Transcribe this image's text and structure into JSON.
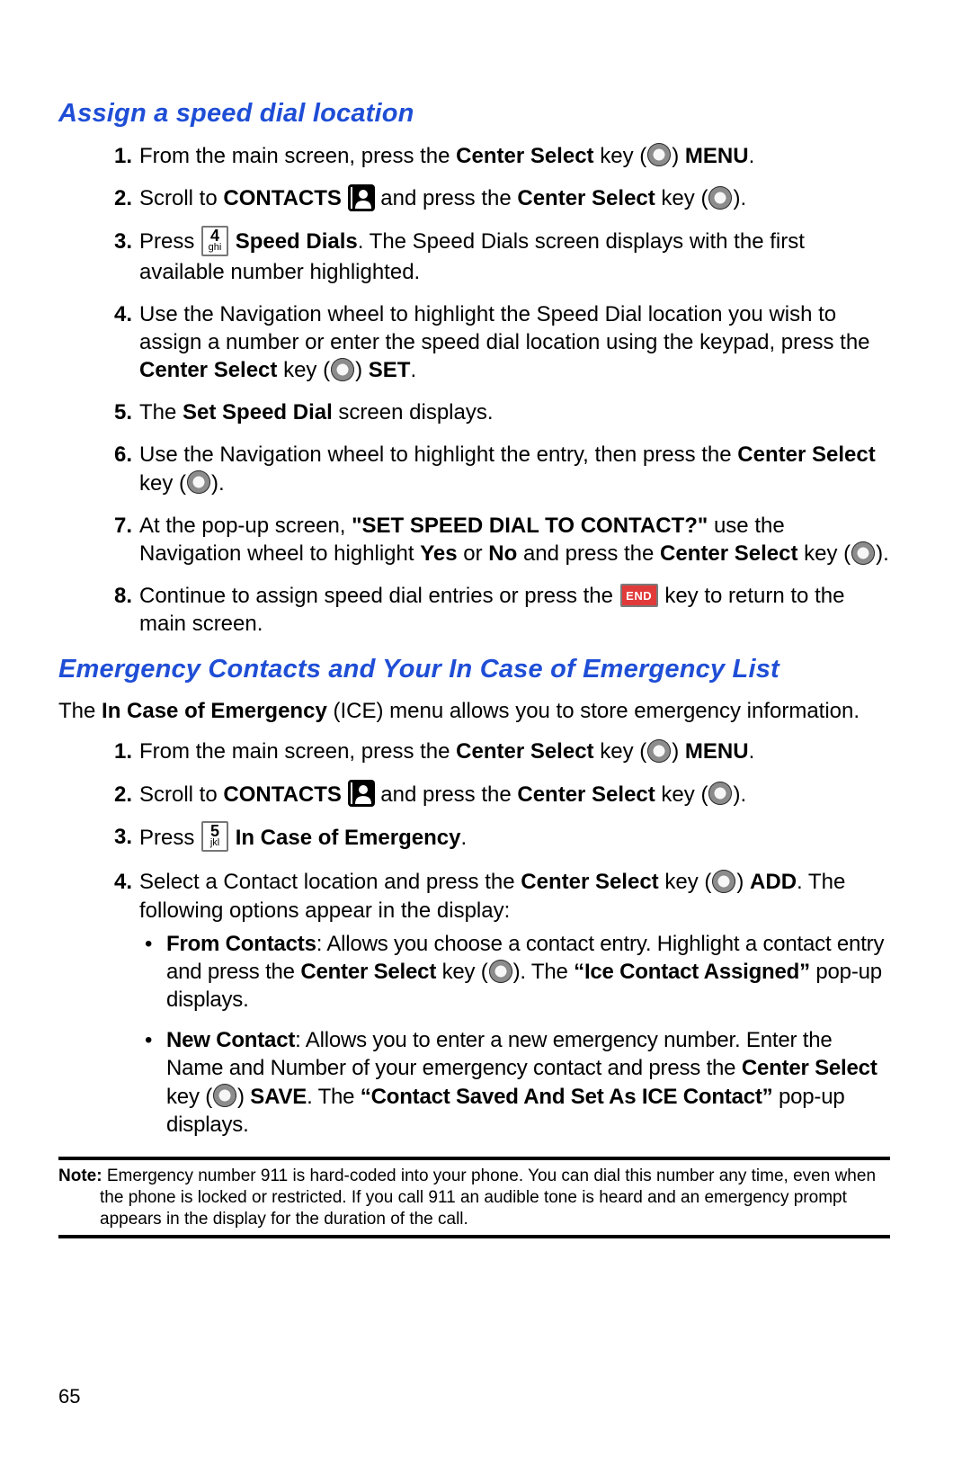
{
  "section1": {
    "heading": "Assign a speed dial location",
    "steps": [
      {
        "num": "1.",
        "parts": [
          "From the main screen, press the ",
          {
            "b": "Center Select"
          },
          " key (",
          {
            "icon": "circle"
          },
          ") ",
          {
            "b": "MENU"
          },
          "."
        ]
      },
      {
        "num": "2.",
        "parts": [
          "Scroll to ",
          {
            "b": "CONTACTS"
          },
          " ",
          {
            "icon": "contacts"
          },
          " and press the ",
          {
            "b": "Center Select"
          },
          " key (",
          {
            "icon": "circle"
          },
          ")."
        ]
      },
      {
        "num": "3.",
        "parts": [
          "Press ",
          {
            "icon": "key",
            "digit": "4",
            "letters": "ghi"
          },
          " ",
          {
            "b": "Speed Dials"
          },
          ". The Speed Dials screen displays with the first available number highlighted."
        ]
      },
      {
        "num": "4.",
        "parts": [
          "Use the Navigation wheel to highlight the Speed Dial location you wish to assign a number or enter the speed dial location using the keypad, press the ",
          {
            "b": "Center Select"
          },
          " key (",
          {
            "icon": "circle"
          },
          ") ",
          {
            "b": "SET"
          },
          "."
        ]
      },
      {
        "num": "5.",
        "parts": [
          "The ",
          {
            "b": "Set Speed Dial"
          },
          " screen displays."
        ]
      },
      {
        "num": "6.",
        "parts": [
          "Use the Navigation wheel to highlight the entry, then press the ",
          {
            "b": "Center Select"
          },
          " key (",
          {
            "icon": "circle"
          },
          ")."
        ]
      },
      {
        "num": "7.",
        "parts": [
          "At the pop-up screen, ",
          {
            "b": "\"SET SPEED DIAL TO CONTACT?\""
          },
          " use the Navigation wheel to highlight ",
          {
            "b": "Yes"
          },
          " or ",
          {
            "b": "No"
          },
          " and press the ",
          {
            "b": "Center Select"
          },
          " key (",
          {
            "icon": "circle"
          },
          ")."
        ]
      },
      {
        "num": "8.",
        "parts": [
          "Continue to assign speed dial entries or press the ",
          {
            "icon": "end",
            "label": "END"
          },
          " key to return to the main screen."
        ]
      }
    ]
  },
  "section2": {
    "heading": "Emergency Contacts and Your In Case of Emergency List",
    "lead": [
      "The ",
      {
        "b": "In Case of Emergency"
      },
      " (ICE) menu allows you to store emergency information."
    ],
    "steps": [
      {
        "num": "1.",
        "parts": [
          "From the main screen, press the ",
          {
            "b": "Center Select"
          },
          " key (",
          {
            "icon": "circle"
          },
          ") ",
          {
            "b": "MENU"
          },
          "."
        ]
      },
      {
        "num": "2.",
        "parts": [
          "Scroll to ",
          {
            "b": "CONTACTS"
          },
          " ",
          {
            "icon": "contacts"
          },
          " and press the ",
          {
            "b": "Center Select"
          },
          " key (",
          {
            "icon": "circle"
          },
          ")."
        ]
      },
      {
        "num": "3.",
        "parts": [
          "Press ",
          {
            "icon": "key",
            "digit": "5",
            "letters": "jkl"
          },
          " ",
          {
            "b": "In Case of Emergency"
          },
          "."
        ]
      },
      {
        "num": "4.",
        "parts": [
          "Select a Contact location and press the ",
          {
            "b": "Center Select"
          },
          " key (",
          {
            "icon": "circle"
          },
          ") ",
          {
            "b": "ADD"
          },
          ". The following options appear in the display:"
        ],
        "bullets": [
          {
            "parts": [
              {
                "b": "From Contacts"
              },
              ": Allows you choose a contact entry. Highlight a contact entry and press the ",
              {
                "b": "Center Select"
              },
              " key (",
              {
                "icon": "circle"
              },
              "). The ",
              {
                "b": "“Ice Contact Assigned”"
              },
              " pop-up displays."
            ],
            "narrow": true
          },
          {
            "parts": [
              {
                "b": "New Contact"
              },
              ": Allows you to enter a new emergency number. Enter the Name and Number of your emergency contact and press the ",
              {
                "b": "Center Select"
              },
              " key (",
              {
                "icon": "circle"
              },
              ") ",
              {
                "b": "SAVE"
              },
              ". The ",
              {
                "b": "“Contact Saved And Set As ICE Contact”"
              },
              " pop-up displays."
            ],
            "narrow": true
          }
        ]
      }
    ]
  },
  "note": {
    "label": "Note:",
    "text": "Emergency number 911 is hard-coded into your phone. You can dial this number any time, even when the phone is locked or restricted. If you call 911 an audible tone is heard and an emergency prompt appears in the display for the duration of the call."
  },
  "page": "65"
}
